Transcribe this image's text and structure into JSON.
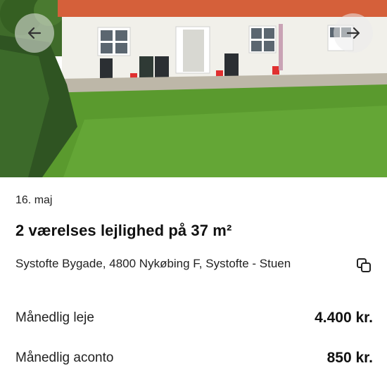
{
  "listing": {
    "date": "16. maj",
    "title": "2 værelses lejlighed på 37 m²",
    "address": "Systofte Bygade, 4800 Nykøbing F, Systofte  - Stuen"
  },
  "details": [
    {
      "label": "Månedlig leje",
      "value": "4.400 kr."
    },
    {
      "label": "Månedlig aconto",
      "value": "850 kr."
    }
  ],
  "icons": {
    "prev": "arrow-left-icon",
    "next": "arrow-right-icon",
    "copy": "copy-icon"
  }
}
